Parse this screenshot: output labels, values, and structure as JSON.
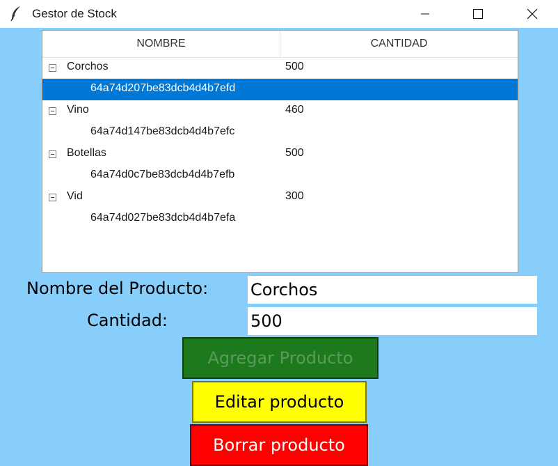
{
  "window": {
    "title": "Gestor de Stock",
    "feather_icon": "feather-icon",
    "controls": [
      "minimize-icon",
      "maximize-icon",
      "close-icon"
    ]
  },
  "tree": {
    "columns": [
      "NOMBRE",
      "CANTIDAD"
    ],
    "rows": [
      {
        "name": "Corchos",
        "qty": "500",
        "expanded": true
      },
      {
        "name": "64a74d207be83dcb4d4b7efd",
        "qty": "",
        "child": true,
        "selected": true
      },
      {
        "name": "Vino",
        "qty": "460",
        "expanded": true
      },
      {
        "name": "64a74d147be83dcb4d4b7efc",
        "qty": "",
        "child": true
      },
      {
        "name": "Botellas",
        "qty": "500",
        "expanded": true
      },
      {
        "name": "64a74d0c7be83dcb4d4b7efb",
        "qty": "",
        "child": true
      },
      {
        "name": "Vid",
        "qty": "300",
        "expanded": true
      },
      {
        "name": "64a74d027be83dcb4d4b7efa",
        "qty": "",
        "child": true
      }
    ]
  },
  "form": {
    "name_label": "Nombre del Producto:",
    "name_value": "Corchos",
    "qty_label": "Cantidad:",
    "qty_value": "500"
  },
  "buttons": {
    "add": "Agregar Producto",
    "edit": "Editar producto",
    "delete": "Borrar producto"
  },
  "colors": {
    "background": "#87cefa",
    "selection": "#0078d7",
    "add_button": "#1c7a1c",
    "edit_button": "#ffff00",
    "delete_button": "#ff0000"
  }
}
